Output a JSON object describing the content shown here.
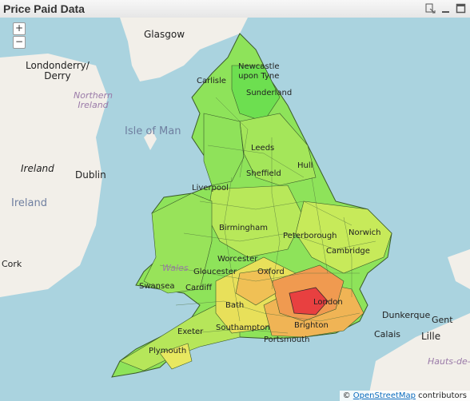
{
  "window": {
    "title": "Price Paid Data"
  },
  "zoom": {
    "in_label": "+",
    "out_label": "−"
  },
  "labels": {
    "glasgow": "Glasgow",
    "londonderry": "Londonderry/\nDerry",
    "northern_ireland": "Northern\nIreland",
    "isle_of_man": "Isle of Man",
    "ireland_region": "Ireland",
    "dublin": "Dublin",
    "ireland_country": "Ireland",
    "cork": "Cork",
    "wales": "Wales",
    "newcastle": "Newcastle\nupon Tyne",
    "carlisle": "Carlisle",
    "sunderland": "Sunderland",
    "leeds": "Leeds",
    "hull": "Hull",
    "sheffield": "Sheffield",
    "liverpool": "Liverpool",
    "birmingham": "Birmingham",
    "peterborough": "Peterborough",
    "norwich": "Norwich",
    "cambridge": "Cambridge",
    "worcester": "Worcester",
    "gloucester": "Gloucester",
    "oxford": "Oxford",
    "swansea": "Swansea",
    "cardiff": "Cardiff",
    "bath": "Bath",
    "london": "London",
    "exeter": "Exeter",
    "southampton": "Southampton",
    "plymouth": "Plymouth",
    "portsmouth": "Portsmouth",
    "brighton": "Brighton",
    "dunkerque": "Dunkerque",
    "calais": "Calais",
    "gent": "Gent",
    "lille": "Lille",
    "hauts_de": "Hauts-de-"
  },
  "attribution": {
    "prefix": "© ",
    "link": "OpenStreetMap",
    "suffix": " contributors"
  },
  "colors": {
    "sea": "#aad3df",
    "land": "#f2efe9",
    "low": "#7de05a",
    "mid": "#d7e85a",
    "high": "#f0a050",
    "top": "#e0303a"
  }
}
